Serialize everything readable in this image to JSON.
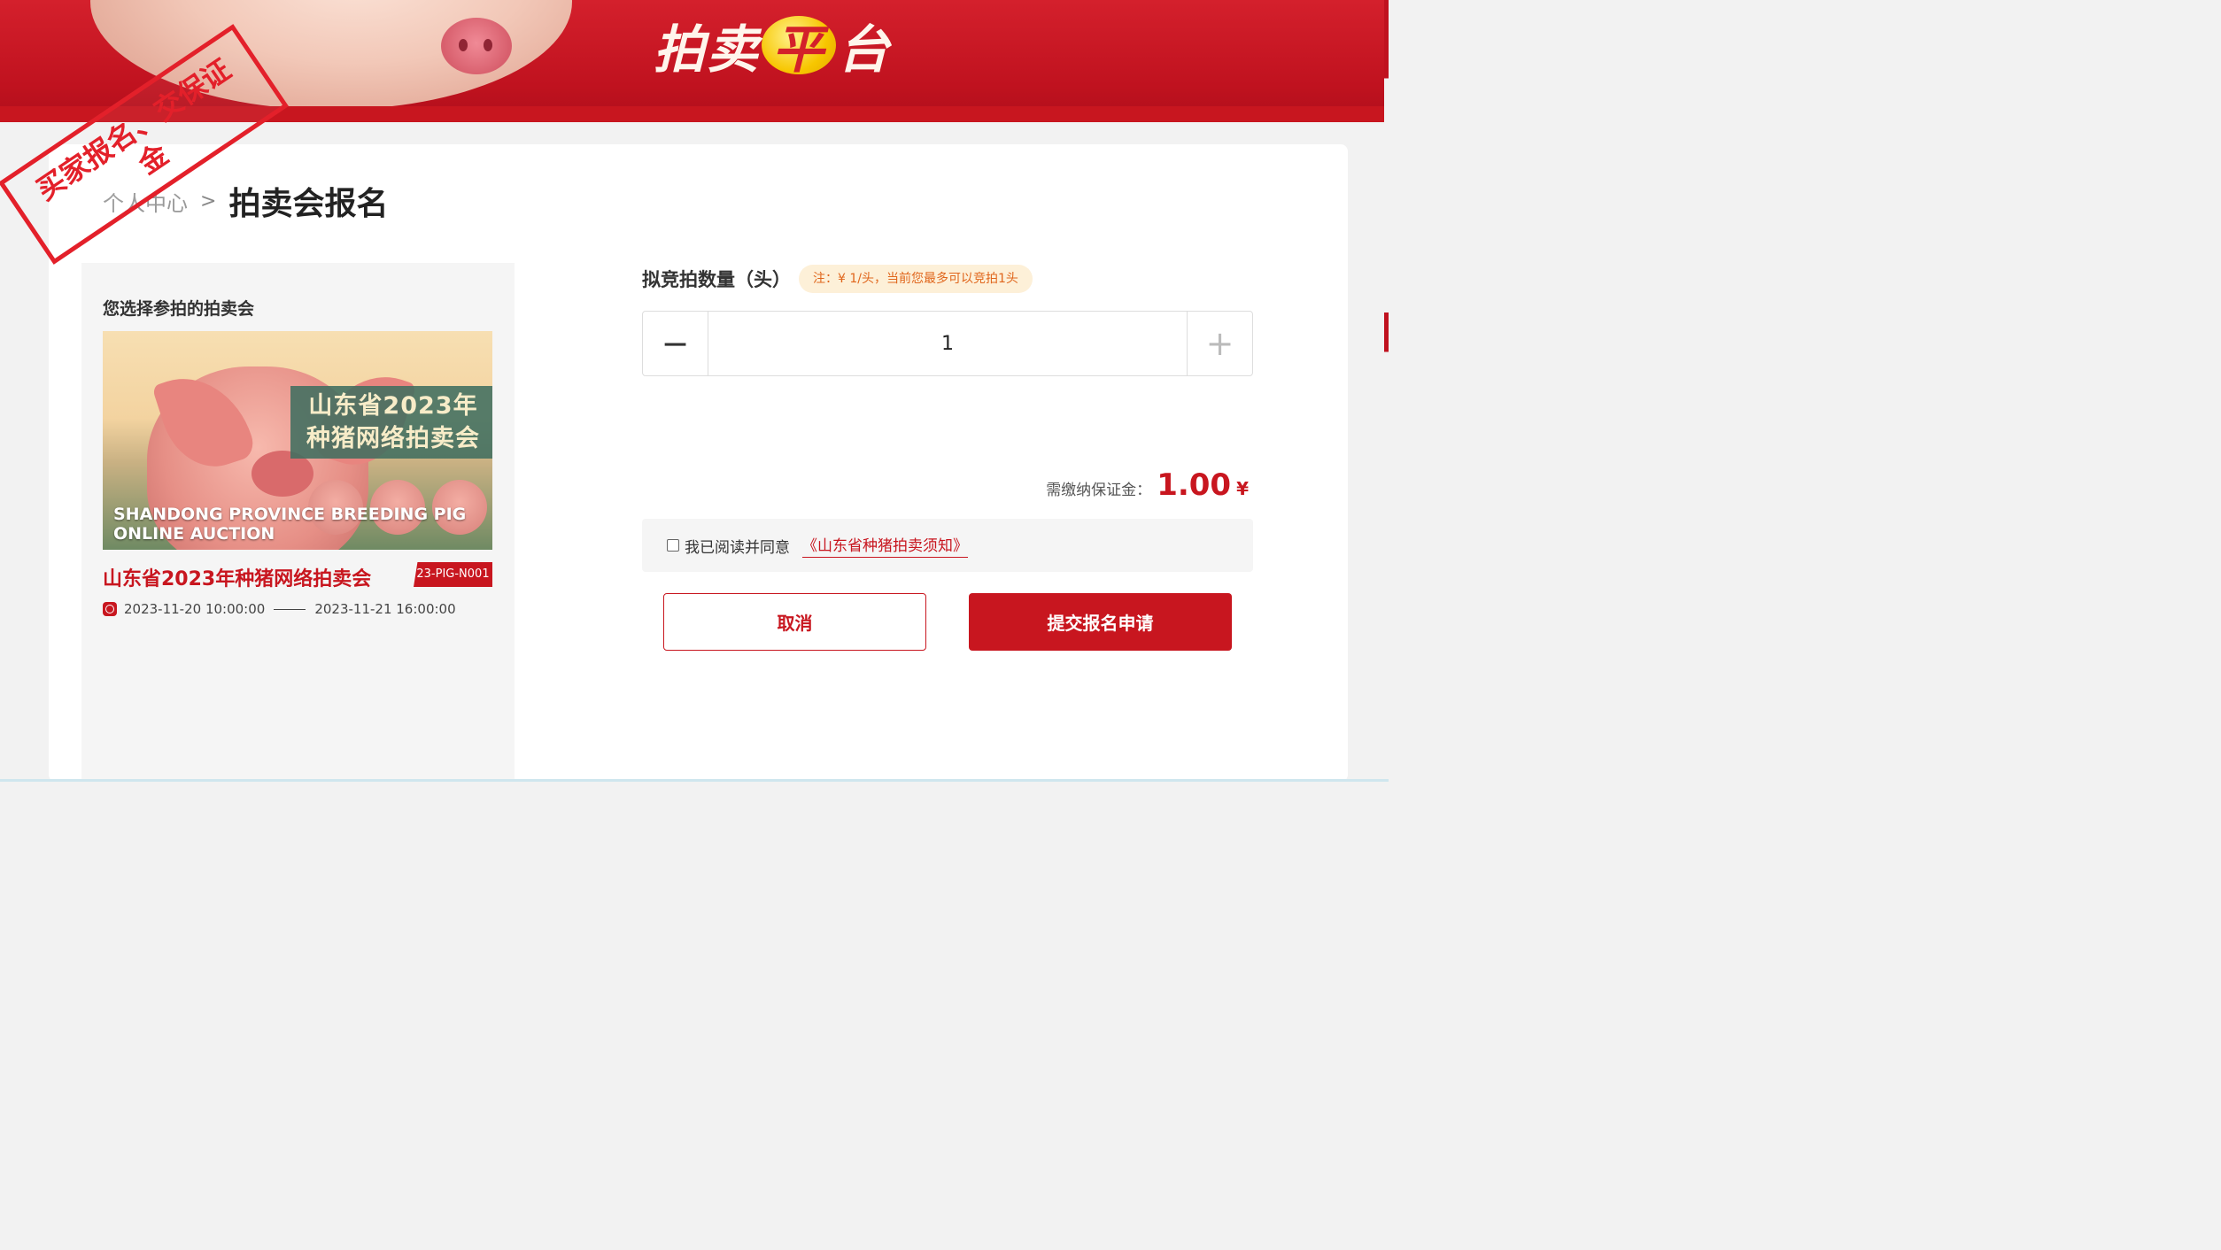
{
  "banner": {
    "title_line1": "",
    "title_prefix": "拍卖",
    "title_coin": "平",
    "title_suffix": "台"
  },
  "stamp": {
    "text": "买家报名、交保证金"
  },
  "breadcrumb": {
    "parent": "个人中心",
    "separator": ">",
    "current": "拍卖会报名"
  },
  "auction_panel": {
    "heading": "您选择参拍的拍卖会",
    "poster": {
      "cn_line1": "山东省2023年",
      "cn_line2": "种猪网络拍卖会",
      "en_line1": "SHANDONG PROVINCE BREEDING PIG",
      "en_line2": "ONLINE AUCTION"
    },
    "title": "山东省2023年种猪网络拍卖会",
    "code": "23-PIG-N001",
    "start_time": "2023-11-20 10:00:00",
    "end_time": "2023-11-21 16:00:00"
  },
  "form": {
    "quantity_label": "拟竞拍数量（头）",
    "quantity_note": "注：¥ 1/头，当前您最多可以竞拍1头",
    "minus_label": "−",
    "plus_label": "+",
    "quantity_value": "1",
    "deposit_label": "需缴纳保证金：",
    "deposit_value": "1.00",
    "deposit_currency": "¥",
    "agree_text": "我已阅读并同意",
    "agree_link": "《山东省种猪拍卖须知》",
    "cancel_label": "取消",
    "submit_label": "提交报名申请"
  },
  "colors": {
    "brand_red": "#c8161f",
    "note_orange": "#e0661c",
    "note_bg": "#fdf0d8"
  }
}
